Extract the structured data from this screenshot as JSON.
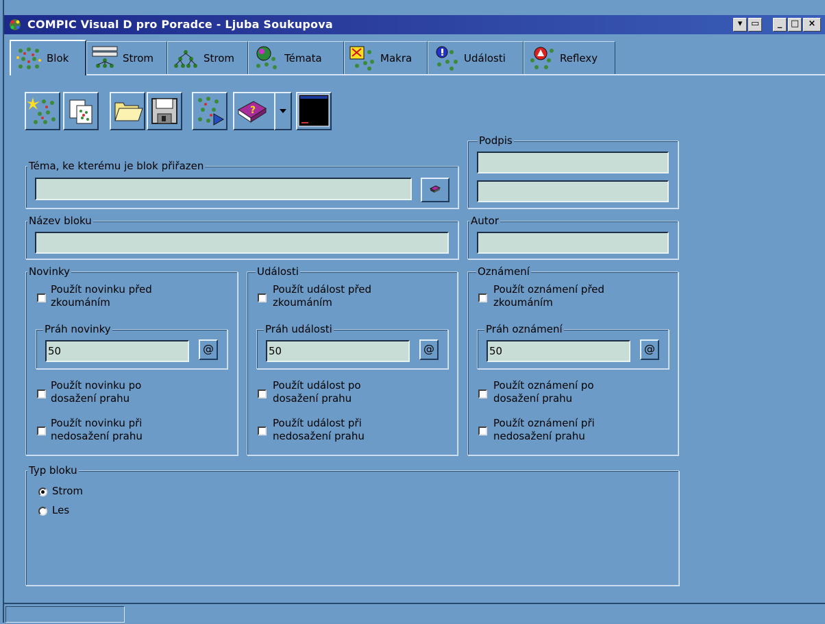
{
  "window": {
    "title": "COMPIC Visual D pro Poradce - Ljuba Soukupova",
    "controls": [
      "▾",
      "▭",
      "_",
      "□",
      "×"
    ]
  },
  "tabs": [
    {
      "label": "Blok",
      "icon": "blok-tab-icon",
      "active": true
    },
    {
      "label": "Strom",
      "icon": "tree-table-icon"
    },
    {
      "label": "Strom",
      "icon": "tree-icon"
    },
    {
      "label": "Témata",
      "icon": "topics-globe-icon"
    },
    {
      "label": "Makra",
      "icon": "macros-icon"
    },
    {
      "label": "Události",
      "icon": "events-icon"
    },
    {
      "label": "Reflexy",
      "icon": "reflexes-icon"
    }
  ],
  "toolbar": {
    "buttons": [
      "new-block-icon",
      "copy-block-icon",
      "open-folder-icon",
      "save-disk-icon",
      "run-block-icon",
      "help-book-icon",
      "dropdown-arrow-icon",
      "console-window-icon"
    ]
  },
  "topic": {
    "legend": "Téma, ke kterému je blok přiřazen",
    "value": ""
  },
  "signature": {
    "legend": "Podpis",
    "line1": "",
    "line2": ""
  },
  "block_name": {
    "legend": "Název bloku",
    "value": ""
  },
  "author": {
    "legend": "Autor",
    "value": ""
  },
  "news": {
    "legend": "Novinky",
    "use_before": "Použít novinku před zkoumáním",
    "use_before_l1": "Použít novinku před",
    "use_before_l2": "zkoumáním",
    "threshold_legend": "Práh novinky",
    "threshold_value": "50",
    "at_label": "@",
    "use_reached_l1": "Použít novinku  po",
    "use_reached_l2": "dosažení prahu",
    "use_not_reached_l1": "Použít novinku při",
    "use_not_reached_l2": "nedosažení prahu"
  },
  "events": {
    "legend": "Události",
    "use_before_l1": "Použít událost před",
    "use_before_l2": "zkoumáním",
    "threshold_legend": "Práh události",
    "threshold_value": "50",
    "at_label": "@",
    "use_reached_l1": "Použít událost po",
    "use_reached_l2": "dosažení prahu",
    "use_not_reached_l1": "Použít událost při",
    "use_not_reached_l2": "nedosažení prahu"
  },
  "announcements": {
    "legend": "Oznámení",
    "use_before_l1": "Použít oznámení před",
    "use_before_l2": "zkoumáním",
    "threshold_legend": "Práh oznámení",
    "threshold_value": "50",
    "at_label": "@",
    "use_reached_l1": "Použít oznámení po",
    "use_reached_l2": "dosažení prahu",
    "use_not_reached_l1": "Použít oznámení při",
    "use_not_reached_l2": "nedosažení prahu"
  },
  "block_type": {
    "legend": "Typ bloku",
    "options": [
      {
        "label": "Strom",
        "selected": true
      },
      {
        "label": "Les",
        "selected": false
      }
    ]
  },
  "statusbar": {
    "text": ""
  }
}
